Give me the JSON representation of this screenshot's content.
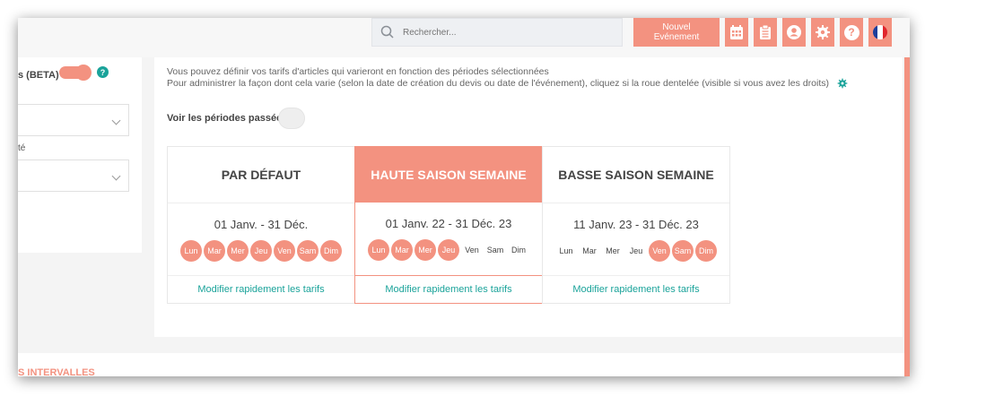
{
  "search": {
    "placeholder": "Rechercher..."
  },
  "toolbar": {
    "new_event_label": "Nouvel Evénement",
    "accent": "#f39280",
    "icons": [
      "calendar-icon",
      "clipboard-icon",
      "user-icon",
      "gear-icon",
      "help-icon",
      "flag-fr-icon"
    ],
    "help_label": "?"
  },
  "sidebar": {
    "beta_label": "s (BETA)",
    "help_badge": "?",
    "field_label": "té"
  },
  "main": {
    "info_line1": "Vous pouvez définir vos tarifs d'articles qui varieront en fonction des périodes sélectionnées",
    "info_line2": "Pour administrer la façon dont cela varie (selon la date de création du devis ou date de l'événement), cliquez si la roue dentelée (visible si vous avez les droits)",
    "past_periods_label": "Voir les périodes passées",
    "periods": [
      {
        "title": "PAR DÉFAUT",
        "dates": "01 Janv. - 31 Déc.",
        "link": "Modifier rapidement les tarifs",
        "days": [
          {
            "label": "Lun",
            "on": true
          },
          {
            "label": "Mar",
            "on": true
          },
          {
            "label": "Mer",
            "on": true
          },
          {
            "label": "Jeu",
            "on": true
          },
          {
            "label": "Ven",
            "on": true
          },
          {
            "label": "Sam",
            "on": true
          },
          {
            "label": "Dim",
            "on": true
          }
        ]
      },
      {
        "title": "HAUTE SAISON SEMAINE",
        "dates": "01 Janv. 22 - 31 Déc. 23",
        "link": "Modifier rapidement les tarifs",
        "days": [
          {
            "label": "Lun",
            "on": true
          },
          {
            "label": "Mar",
            "on": true
          },
          {
            "label": "Mer",
            "on": true
          },
          {
            "label": "Jeu",
            "on": true
          },
          {
            "label": "Ven",
            "on": false
          },
          {
            "label": "Sam",
            "on": false
          },
          {
            "label": "Dim",
            "on": false
          }
        ]
      },
      {
        "title": "BASSE SAISON SEMAINE",
        "dates": "11 Janv. 23 - 31 Déc. 23",
        "link": "Modifier rapidement les tarifs",
        "days": [
          {
            "label": "Lun",
            "on": false
          },
          {
            "label": "Mar",
            "on": false
          },
          {
            "label": "Mer",
            "on": false
          },
          {
            "label": "Jeu",
            "on": false
          },
          {
            "label": "Ven",
            "on": true
          },
          {
            "label": "Sam",
            "on": true
          },
          {
            "label": "Dim",
            "on": true
          }
        ]
      }
    ]
  },
  "bottom": {
    "section_label": "S INTERVALLES"
  }
}
